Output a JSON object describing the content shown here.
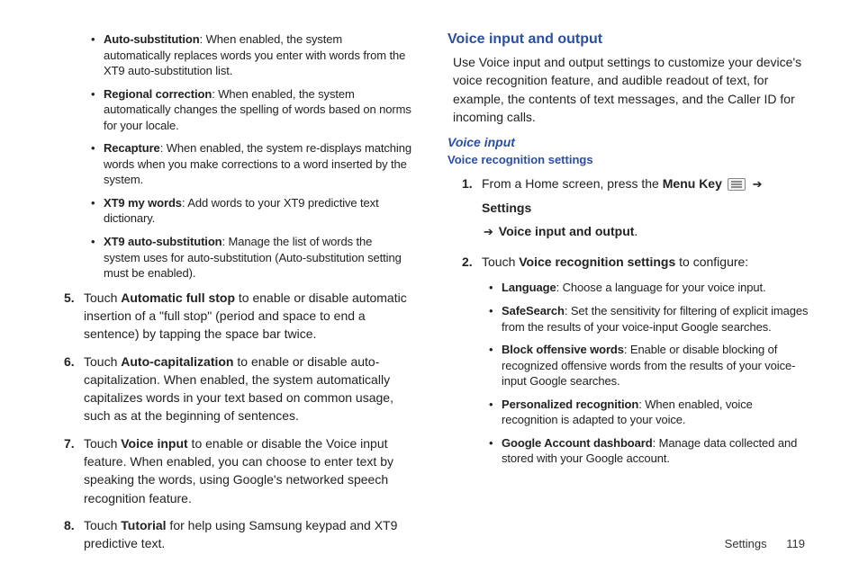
{
  "left": {
    "bullets": [
      {
        "term": "Auto-substitution",
        "desc": ": When enabled, the system automatically replaces words you enter with words from the XT9 auto-substitution list."
      },
      {
        "term": "Regional correction",
        "desc": ": When enabled, the system automatically changes the spelling of words based on norms for your locale."
      },
      {
        "term": "Recapture",
        "desc": ": When enabled, the system re-displays matching words when you make corrections to a word inserted by the system."
      },
      {
        "term": "XT9 my words",
        "desc": ": Add words to your XT9 predictive text dictionary."
      },
      {
        "term": "XT9 auto-substitution",
        "desc": ": Manage the list of words the system uses for auto-substitution (Auto-substitution setting must be enabled)."
      }
    ],
    "steps": [
      {
        "n": "5.",
        "pre": "Touch ",
        "bold": "Automatic full stop",
        "post": " to enable or disable automatic insertion of a \"full stop\" (period and space to end a sentence) by tapping the space bar twice."
      },
      {
        "n": "6.",
        "pre": "Touch ",
        "bold": "Auto-capitalization",
        "post": " to enable or disable auto-capitalization. When enabled, the system automatically capitalizes words in your text based on common usage, such as at the beginning of sentences."
      },
      {
        "n": "7.",
        "pre": "Touch ",
        "bold": "Voice input",
        "post": " to enable or disable the Voice input feature. When enabled, you can choose to enter text by speaking the words, using Google's networked speech recognition feature."
      },
      {
        "n": "8.",
        "pre": "Touch ",
        "bold": "Tutorial",
        "post": " for help using Samsung keypad and XT9 predictive text."
      }
    ]
  },
  "right": {
    "heading": "Voice input and output",
    "intro": "Use Voice input and output settings to customize your device's voice recognition feature, and audible readout of text, for example, the contents of text messages, and the Caller ID for incoming calls.",
    "sub1": "Voice input",
    "sub2": "Voice recognition settings",
    "step1": {
      "n": "1.",
      "textA": "From a Home screen, press the ",
      "menuKey": "Menu Key",
      "settings": "Settings",
      "line2bold": "Voice input and output",
      "period": "."
    },
    "step2": {
      "n": "2.",
      "pre": "Touch ",
      "bold": "Voice recognition settings",
      "post": " to configure:"
    },
    "bullets": [
      {
        "term": "Language",
        "desc": ": Choose a language for your voice input."
      },
      {
        "term": "SafeSearch",
        "desc": ": Set the sensitivity for filtering of explicit images from the results of your voice-input Google searches."
      },
      {
        "term": "Block offensive words",
        "desc": ": Enable or disable blocking of recognized offensive words from the results of your voice-input Google searches."
      },
      {
        "term": "Personalized recognition",
        "desc": ": When enabled, voice recognition is adapted to your voice."
      },
      {
        "term": "Google Account dashboard",
        "desc": ": Manage data collected and stored with your Google account."
      }
    ]
  },
  "footer": {
    "section": "Settings",
    "page": "119"
  },
  "arrow": "➔"
}
